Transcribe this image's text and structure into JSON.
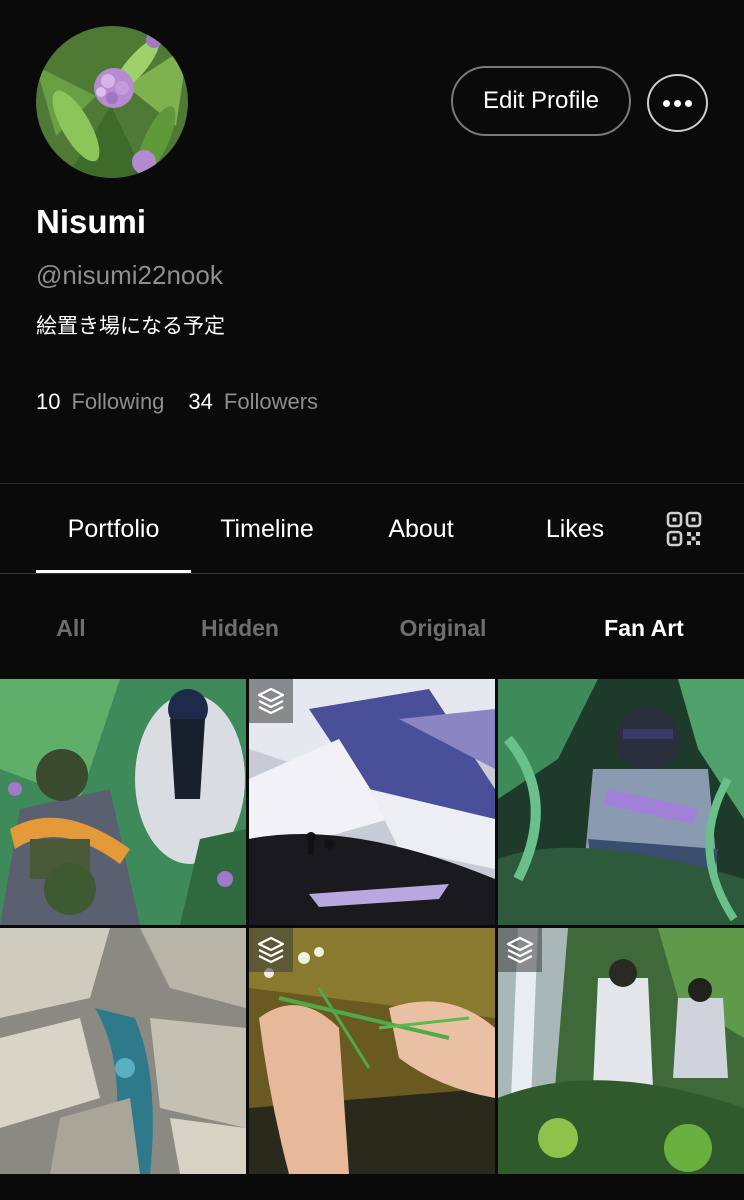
{
  "profile": {
    "name": "Nisumi",
    "handle": "@nisumi22nook",
    "bio": "絵置き場になる予定",
    "following_count": "10",
    "following_label": "Following",
    "followers_count": "34",
    "followers_label": "Followers"
  },
  "actions": {
    "edit_label": "Edit Profile",
    "more_icon": "more-horizontal-icon"
  },
  "tabs": [
    {
      "label": "Portfolio",
      "active": true
    },
    {
      "label": "Timeline",
      "active": false
    },
    {
      "label": "About",
      "active": false
    },
    {
      "label": "Likes",
      "active": false
    }
  ],
  "qr_icon": "qr-code-icon",
  "filters": [
    {
      "label": "All",
      "active": false
    },
    {
      "label": "Hidden",
      "active": false
    },
    {
      "label": "Original",
      "active": false
    },
    {
      "label": "Fan Art",
      "active": true
    }
  ],
  "gallery": [
    {
      "multi_image": false
    },
    {
      "multi_image": true
    },
    {
      "multi_image": false
    },
    {
      "multi_image": false
    },
    {
      "multi_image": true
    },
    {
      "multi_image": true
    }
  ],
  "colors": {
    "background": "#0a0a0a",
    "muted_text": "#8e8e8e",
    "inactive_filter": "#6e6e6e"
  }
}
